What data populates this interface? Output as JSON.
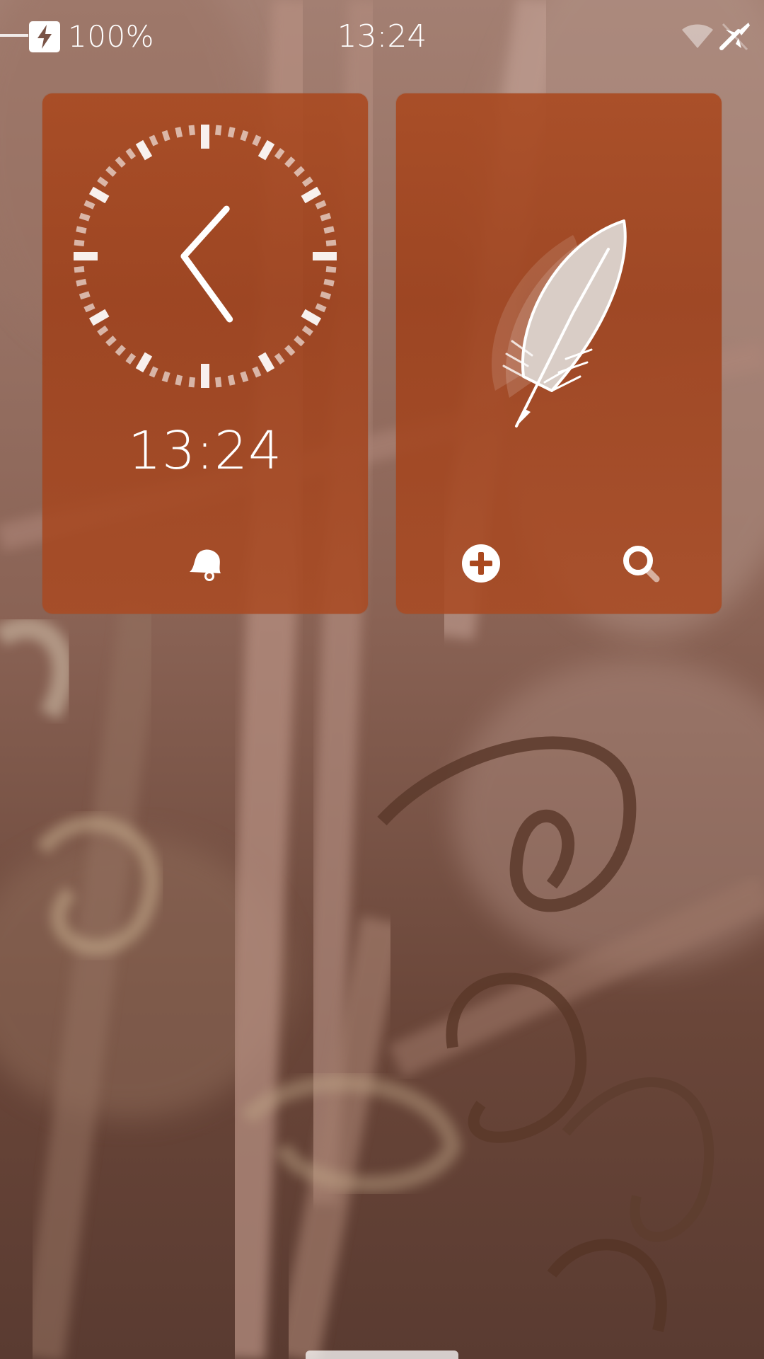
{
  "status_bar": {
    "battery_level": "100%",
    "time": "13:24",
    "icons": [
      "charger-plug-icon",
      "battery-charging-icon",
      "wifi-icon",
      "flight-mode-icon"
    ]
  },
  "clock_cover": {
    "time": "13:24",
    "analog_hour": 13,
    "analog_minute": 24,
    "action_icon": "alarm-bell-icon"
  },
  "notes_cover": {
    "icon": "feather-icon",
    "actions": [
      "add-icon",
      "search-icon"
    ]
  },
  "colors": {
    "tile": "#a9481e",
    "foreground": "#ffffff"
  }
}
